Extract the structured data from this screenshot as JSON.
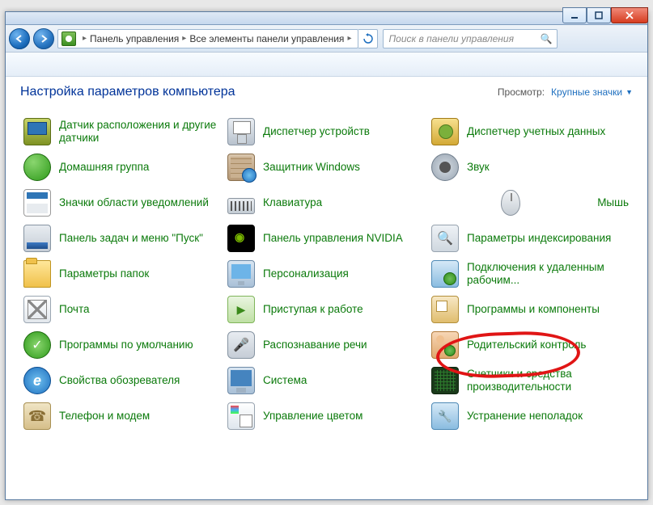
{
  "titlebar": {},
  "nav": {
    "breadcrumb": [
      "Панель управления",
      "Все элементы панели управления"
    ],
    "search_placeholder": "Поиск в панели управления"
  },
  "heading": "Настройка параметров компьютера",
  "view": {
    "label": "Просмотр:",
    "value": "Крупные значки"
  },
  "items": [
    {
      "label": "Датчик расположения и другие датчики",
      "icon": "i-screen"
    },
    {
      "label": "Диспетчер устройств",
      "icon": "i-device"
    },
    {
      "label": "Диспетчер учетных данных",
      "icon": "i-accounts"
    },
    {
      "label": "Домашняя группа",
      "icon": "i-globe green"
    },
    {
      "label": "Защитник Windows",
      "icon": "i-wall"
    },
    {
      "label": "Звук",
      "icon": "i-speaker"
    },
    {
      "label": "Значки области уведомлений",
      "icon": "i-tray"
    },
    {
      "label": "Клавиатура",
      "icon": "i-kbd"
    },
    {
      "label": "Мышь",
      "icon": "i-mouse"
    },
    {
      "label": "Панель задач и меню \"Пуск\"",
      "icon": "i-task"
    },
    {
      "label": "Панель управления NVIDIA",
      "icon": "i-nvidia"
    },
    {
      "label": "Параметры индексирования",
      "icon": "i-search"
    },
    {
      "label": "Параметры папок",
      "icon": "i-folder"
    },
    {
      "label": "Персонализация",
      "icon": "i-monitor"
    },
    {
      "label": "Подключения к удаленным рабочим...",
      "icon": "i-net"
    },
    {
      "label": "Почта",
      "icon": "i-mail"
    },
    {
      "label": "Приступая к работе",
      "icon": "i-start"
    },
    {
      "label": "Программы и компоненты",
      "icon": "i-progs"
    },
    {
      "label": "Программы по умолчанию",
      "icon": "i-default"
    },
    {
      "label": "Распознавание речи",
      "icon": "i-mic"
    },
    {
      "label": "Родительский контроль",
      "icon": "i-parent"
    },
    {
      "label": "Свойства обозревателя",
      "icon": "i-ie"
    },
    {
      "label": "Система",
      "icon": "i-sys"
    },
    {
      "label": "Счетчики и средства производительности",
      "icon": "i-perf"
    },
    {
      "label": "Телефон и модем",
      "icon": "i-phone"
    },
    {
      "label": "Управление цветом",
      "icon": "i-color"
    },
    {
      "label": "Устранение неполадок",
      "icon": "i-fix"
    }
  ]
}
